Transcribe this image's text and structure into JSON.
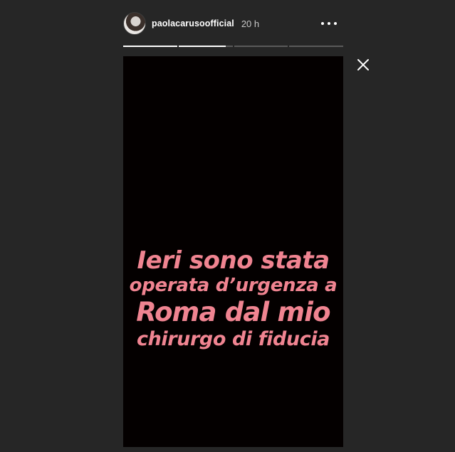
{
  "header": {
    "username": "paolacarusoofficial",
    "time": "20 h"
  },
  "progress": {
    "segments": [
      1.0,
      0.88,
      0.0,
      0.0
    ]
  },
  "icons": {
    "avatar": "profile-photo",
    "more": "more-options-icon",
    "close": "close-icon"
  },
  "story": {
    "text_color": "#f08491",
    "background": "#040000",
    "lines": [
      "Ieri sono stata",
      "operata d’urgenza a",
      "Roma dal mio",
      "chirurgo di fiducia"
    ]
  }
}
